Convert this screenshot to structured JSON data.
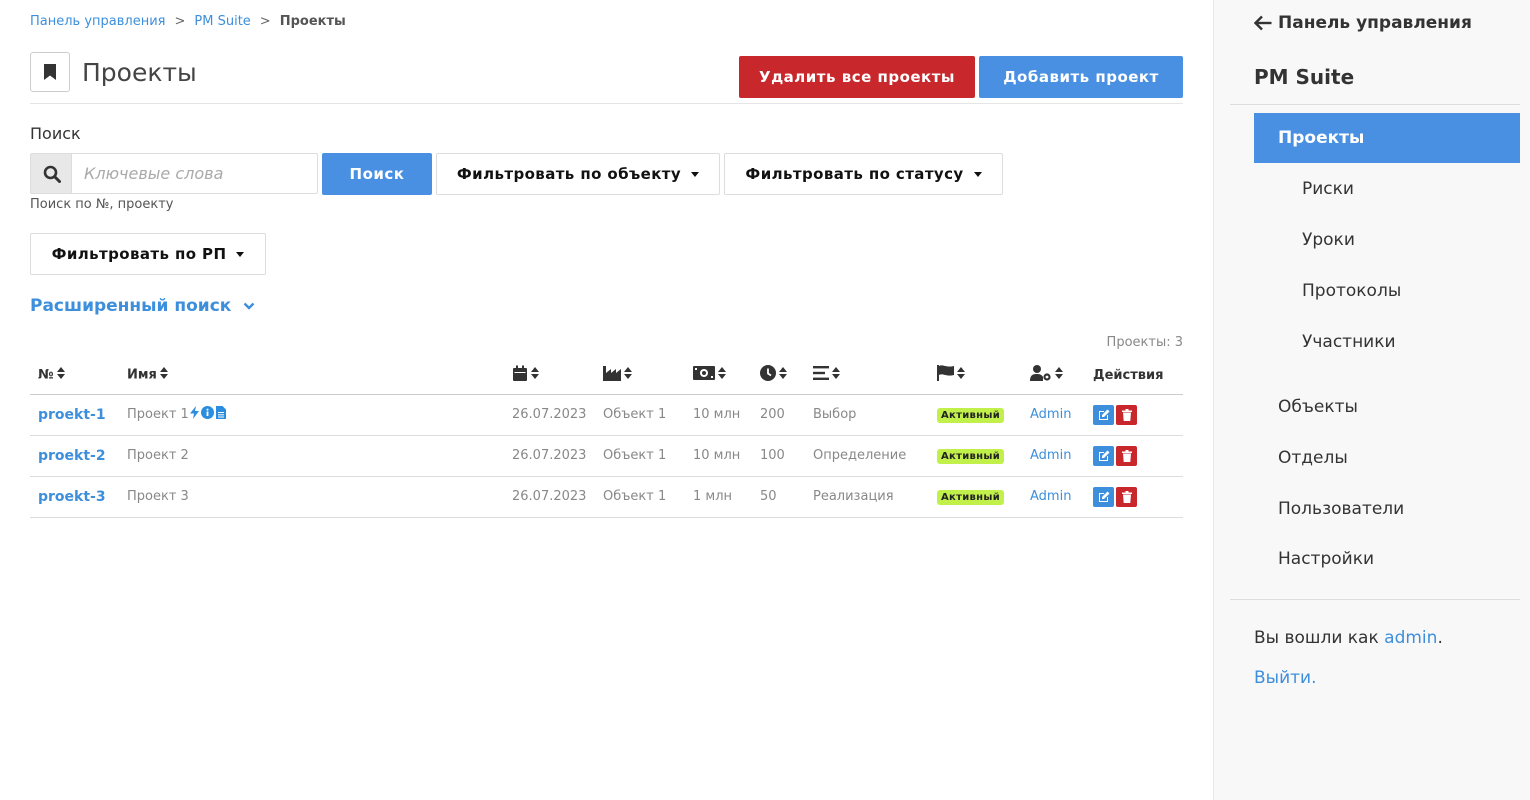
{
  "breadcrumb": {
    "item1": "Панель управления",
    "item2": "PM Suite",
    "current": "Проекты",
    "separator": ">"
  },
  "header": {
    "title": "Проекты",
    "icon": "bookmark-icon",
    "delete_all_label": "Удалить все проекты",
    "add_label": "Добавить проект"
  },
  "search": {
    "label": "Поиск",
    "placeholder": "Ключевые слова",
    "value": "",
    "button_label": "Поиск",
    "hint": "Поиск по №, проекту",
    "filter_object": "Фильтровать по объекту",
    "filter_status": "Фильтровать по статусу",
    "filter_pm": "Фильтровать по РП",
    "advanced": "Расширенный поиск"
  },
  "table": {
    "count_text": "Проекты: 3",
    "headers": {
      "number": "№",
      "name": "Имя",
      "date_icon": "calendar-icon",
      "object_icon": "industry-icon",
      "budget_icon": "money-icon",
      "duration_icon": "clock-icon",
      "phase_icon": "list-icon",
      "status_icon": "flag-icon",
      "manager_icon": "user-cog-icon",
      "actions": "Действия"
    },
    "rows": [
      {
        "code": "proekt-1",
        "name": "Проект 1",
        "date": "26.07.2023",
        "object": "Объект 1",
        "budget": "10 млн",
        "duration": "200",
        "phase": "Выбор",
        "status": "Активный",
        "manager": "Admin"
      },
      {
        "code": "proekt-2",
        "name": "Проект 2",
        "date": "26.07.2023",
        "object": "Объект 1",
        "budget": "10 млн",
        "duration": "100",
        "phase": "Определение",
        "status": "Активный",
        "manager": "Admin"
      },
      {
        "code": "proekt-3",
        "name": "Проект 3",
        "date": "26.07.2023",
        "object": "Объект 1",
        "budget": "1 млн",
        "duration": "50",
        "phase": "Реализация",
        "status": "Активный",
        "manager": "Admin"
      }
    ]
  },
  "sidebar": {
    "back_label": "Панель управления",
    "app_title": "PM Suite",
    "items": [
      {
        "label": "Проекты",
        "active": true
      },
      {
        "label": "Риски"
      },
      {
        "label": "Уроки"
      },
      {
        "label": "Протоколы"
      },
      {
        "label": "Участники"
      },
      {
        "label": "Объекты"
      },
      {
        "label": "Отделы"
      },
      {
        "label": "Пользователи"
      },
      {
        "label": "Настройки"
      }
    ],
    "login_prefix": "Вы вошли как",
    "login_user": "admin",
    "login_suffix": ".",
    "logout": "Выйти."
  },
  "colors": {
    "primary": "#4a90e2",
    "danger": "#c8272c",
    "link": "#3d8fdc",
    "badge": "#c2f04a"
  }
}
